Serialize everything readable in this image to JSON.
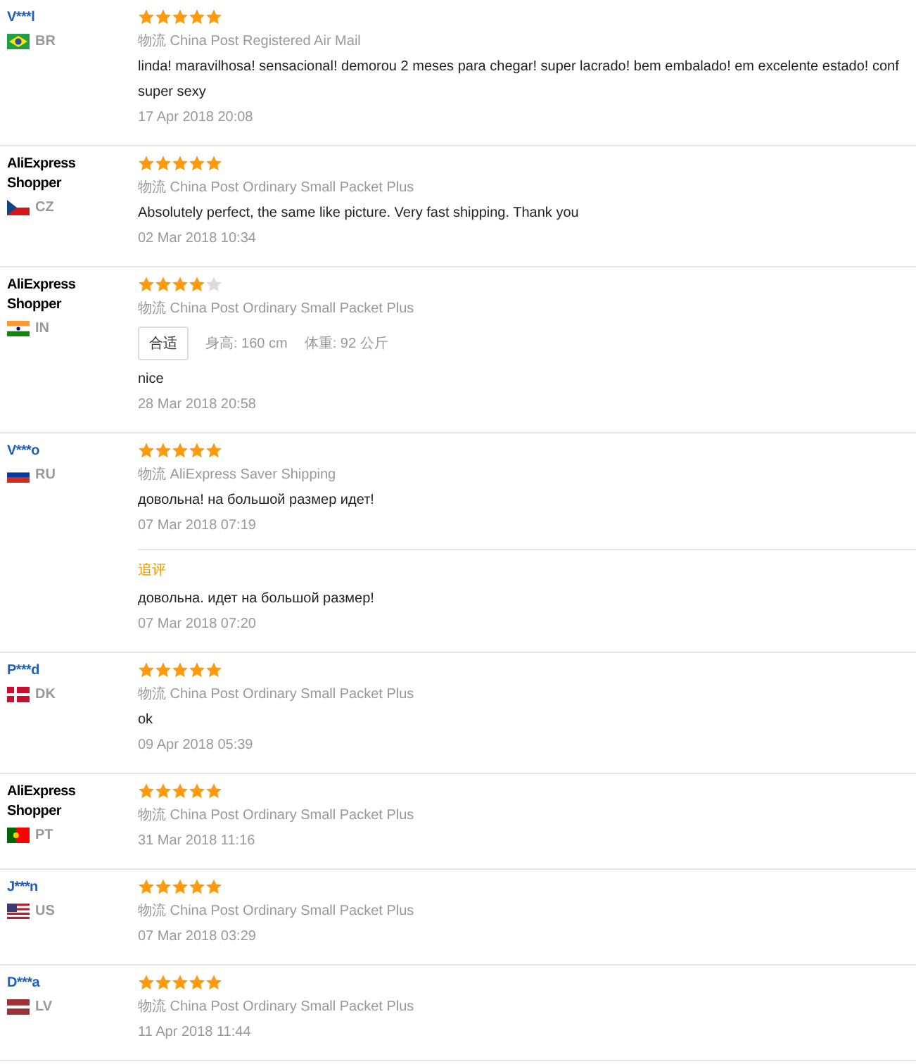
{
  "reviews": [
    {
      "user": "V***l",
      "kind": "buyer",
      "flag": {
        "kind": "br"
      },
      "country": "BR",
      "stars": 5,
      "shipping_label": "物流",
      "shipping": "China Post Registered Air Mail",
      "text": [
        "linda! maravilhosa! sensacional! demorou 2 meses para chegar! super lacrado! bem embalado! em excelente estado! conf",
        "super sexy"
      ],
      "date": "17 Apr 2018 20:08"
    },
    {
      "user": "AliExpress Shopper",
      "kind": "anonymous",
      "flag": {
        "kind": "cz"
      },
      "country": "CZ",
      "stars": 5,
      "shipping_label": "物流",
      "shipping": "China Post Ordinary Small Packet Plus",
      "text": [
        "Absolutely perfect, the same like picture. Very fast shipping. Thank you"
      ],
      "date": "02 Mar 2018 10:34"
    },
    {
      "user": "AliExpress Shopper",
      "kind": "anonymous",
      "flag": {
        "kind": "in"
      },
      "country": "IN",
      "stars": 4,
      "shipping_label": "物流",
      "shipping": "China Post Ordinary Small Packet Plus",
      "fit": {
        "tag": "合适",
        "height_label": "身高:",
        "height": "160 cm",
        "weight_label": "体重:",
        "weight": "92 公斤"
      },
      "text": [
        "nice"
      ],
      "date": "28 Mar 2018 20:58"
    },
    {
      "user": "V***o",
      "kind": "buyer",
      "flag": {
        "kind": "ru"
      },
      "country": "RU",
      "stars": 5,
      "shipping_label": "物流",
      "shipping": "AliExpress Saver Shipping",
      "text": [
        "довольна! на большой размер идет!"
      ],
      "date": "07 Mar 2018 07:19",
      "followup": {
        "label": "追评",
        "text": "довольна. идет на большой размер!",
        "date": "07 Mar 2018 07:20"
      }
    },
    {
      "user": "P***d",
      "kind": "buyer",
      "flag": {
        "kind": "dk"
      },
      "country": "DK",
      "stars": 5,
      "shipping_label": "物流",
      "shipping": "China Post Ordinary Small Packet Plus",
      "text": [
        "ok"
      ],
      "date": "09 Apr 2018 05:39"
    },
    {
      "user": "AliExpress Shopper",
      "kind": "anonymous",
      "flag": {
        "kind": "pt"
      },
      "country": "PT",
      "stars": 5,
      "shipping_label": "物流",
      "shipping": "China Post Ordinary Small Packet Plus",
      "date": "31 Mar 2018 11:16"
    },
    {
      "user": "J***n",
      "kind": "buyer",
      "flag": {
        "kind": "us"
      },
      "country": "US",
      "stars": 5,
      "shipping_label": "物流",
      "shipping": "China Post Ordinary Small Packet Plus",
      "date": "07 Mar 2018 03:29"
    },
    {
      "user": "D***a",
      "kind": "buyer",
      "flag": {
        "kind": "lv"
      },
      "country": "LV",
      "stars": 5,
      "shipping_label": "物流",
      "shipping": "China Post Ordinary Small Packet Plus",
      "date": "11 Apr 2018 11:44"
    }
  ]
}
